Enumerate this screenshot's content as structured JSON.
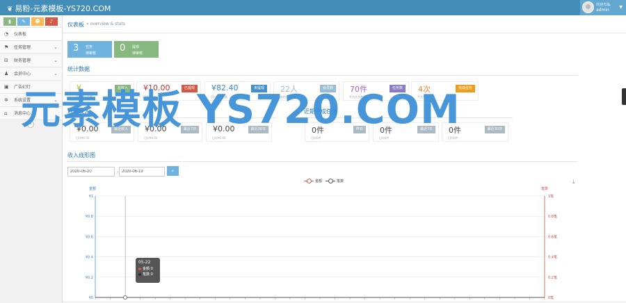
{
  "brand": {
    "title": "易粉-元素模板-YS720.COM"
  },
  "user": {
    "welcome": "欢迎光临,",
    "name": "admin"
  },
  "shortcuts": [
    {
      "icon": "chart-icon",
      "color": "#87b87f"
    },
    {
      "icon": "pencil-icon",
      "color": "#6fb3e0"
    },
    {
      "icon": "group-icon",
      "color": "#ffb752"
    },
    {
      "icon": "bell-icon",
      "color": "#d15b47"
    }
  ],
  "menu": [
    {
      "label": "仪表板",
      "icon": "dashboard-icon"
    },
    {
      "label": "任务管理",
      "icon": "flag-icon"
    },
    {
      "label": "财务管理",
      "icon": "finance-icon"
    },
    {
      "label": "会员中心",
      "icon": "users-icon"
    },
    {
      "label": "广告幻灯",
      "icon": "picture-icon"
    },
    {
      "label": "系统设置",
      "icon": "gear-icon"
    },
    {
      "label": "消息中心",
      "icon": "bookmark-icon"
    }
  ],
  "breadcrumb": {
    "title": "仪表板",
    "subtitle": "» overview & stats"
  },
  "tiles": [
    {
      "value": "3",
      "line1": "任务",
      "line2": "待审核",
      "color": "#6fb3e0"
    },
    {
      "value": "0",
      "line1": "提现",
      "line2": "待审核",
      "color": "#87b87f"
    }
  ],
  "sections": {
    "stats": "统计数据",
    "recent_income": "近期收入",
    "recent_tasks": "近期完成任务",
    "trend": "收入线形图"
  },
  "stats": [
    {
      "value": "¥",
      "sub": "平台收入总额",
      "tag": "总收入",
      "tag_color": "#87b87f",
      "value_color": "#b5b828"
    },
    {
      "value": "¥10.00",
      "sub": "已提现总额",
      "tag": "已提现",
      "tag_color": "#d15b47",
      "value_color": "#c03633"
    },
    {
      "value": "¥82.40",
      "sub": "用户余额总额",
      "tag": "未提现",
      "tag_color": "#478fca",
      "value_color": "#3a8ac4"
    },
    {
      "value": "22人",
      "sub": "我的会员数量",
      "tag": "会员数",
      "tag_color": "#9abcd4",
      "value_color": "#9abcd4"
    },
    {
      "value": "70件",
      "sub": "平台任务数量",
      "tag": "任务数",
      "tag_color": "#8a7dc4",
      "value_color": "#a069c3"
    },
    {
      "value": "4次",
      "sub": "平台完成次数",
      "tag": "完成任务",
      "tag_color": "#ee9c1b",
      "value_color": "#e28a3a"
    }
  ],
  "income": [
    {
      "value": "¥0.00",
      "sub": "日均¥0.00",
      "tag": "最近收入"
    },
    {
      "value": "¥0.00",
      "sub": "日均¥0.00",
      "tag": "最近7日"
    },
    {
      "value": "¥0.00",
      "sub": "日均¥0.00",
      "tag": "最近30日"
    }
  ],
  "tasks": [
    {
      "value": "0件",
      "sub": "日均0件",
      "tag": "昨日"
    },
    {
      "value": "0件",
      "sub": "日均0件",
      "tag": "最近7日"
    },
    {
      "value": "0件",
      "sub": "日均0件",
      "tag": "最近30日"
    }
  ],
  "filters": {
    "start": "2020-05-20",
    "end": "2020-06-19",
    "sep": "-"
  },
  "chart_data": {
    "type": "line",
    "legend_position": "top",
    "grid": true,
    "left_axis_label": "金额",
    "right_axis_label": "笔数",
    "left_ticks": [
      "¥1",
      "¥0.8",
      "¥0.6",
      "¥0.4",
      "¥0.2",
      "¥0"
    ],
    "right_ticks": [
      "1笔",
      "0.8笔",
      "0.6笔",
      "0.4笔",
      "0.2笔",
      "0笔"
    ],
    "ylim": [
      0,
      1
    ],
    "series": [
      {
        "name": "金额",
        "color": "#d15b47",
        "values": [
          0,
          0,
          0,
          0,
          0,
          0,
          0,
          0,
          0,
          0,
          0,
          0,
          0,
          0,
          0,
          0,
          0,
          0,
          0,
          0,
          0,
          0,
          0,
          0,
          0,
          0,
          0,
          0,
          0,
          0,
          0
        ]
      },
      {
        "name": "笔数",
        "color": "#555555",
        "values": [
          0,
          0,
          0,
          0,
          0,
          0,
          0,
          0,
          0,
          0,
          0,
          0,
          0,
          0,
          0,
          0,
          0,
          0,
          0,
          0,
          0,
          0,
          0,
          0,
          0,
          0,
          0,
          0,
          0,
          0,
          0
        ]
      }
    ],
    "tooltip": {
      "date": "05-22",
      "amount_label": "金额:",
      "amount": "0",
      "count_label": "笔数:",
      "count": "0"
    }
  },
  "watermark": "元素模板 YS720.COM"
}
